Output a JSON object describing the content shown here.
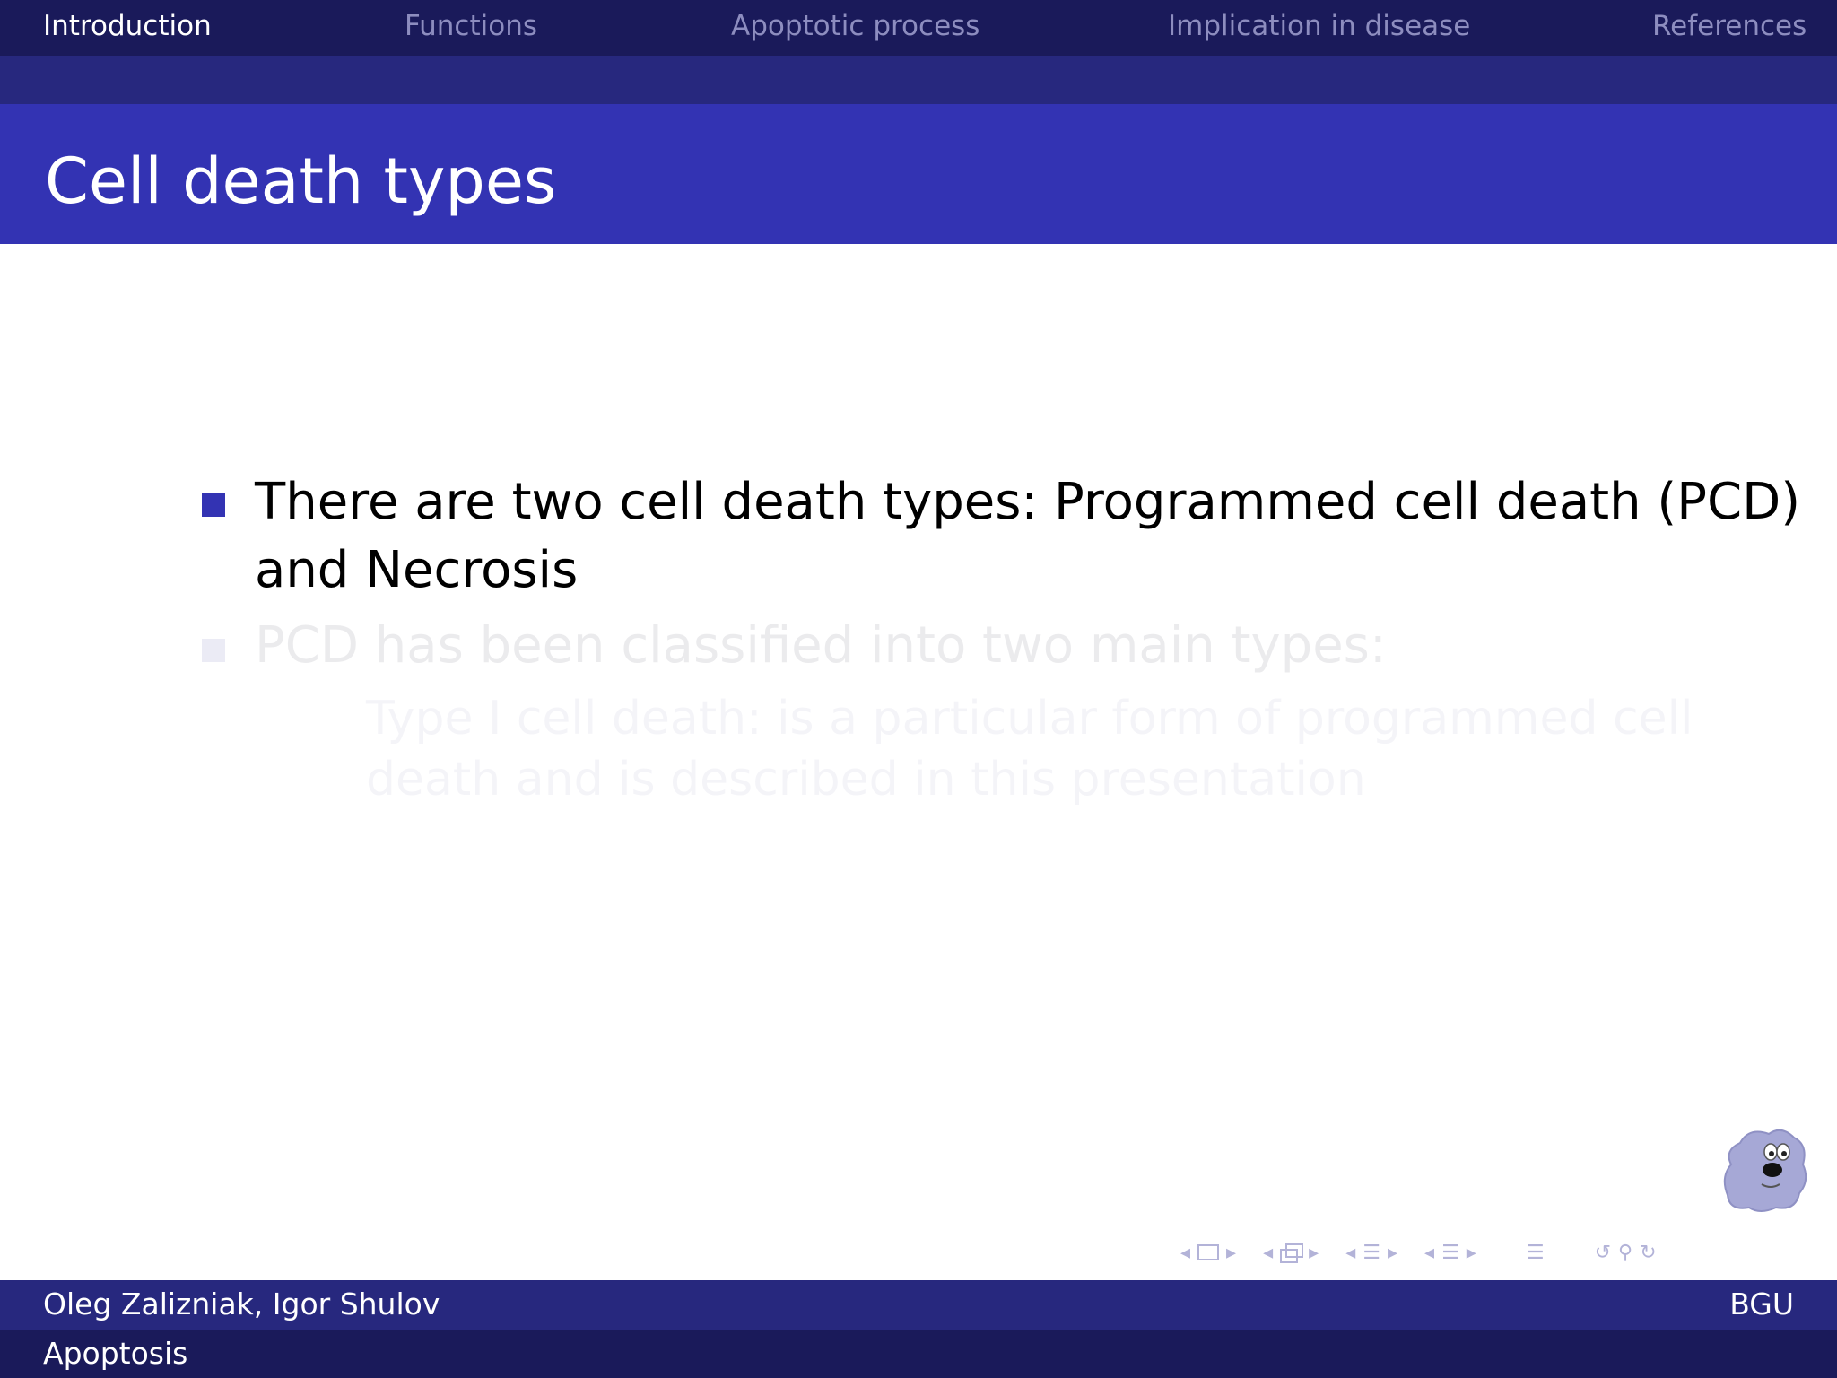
{
  "nav": {
    "sections": [
      "Introduction",
      "Functions",
      "Apoptotic process",
      "Implication in disease",
      "References"
    ],
    "active_index": 0
  },
  "frame": {
    "title": "Cell death types"
  },
  "bullets": [
    {
      "line1": "There are two cell death types: Programmed cell death (PCD)",
      "line2": "and Necrosis",
      "state": "visible"
    },
    {
      "line1": "PCD has been classified into two main types:",
      "state": "faded"
    }
  ],
  "subitem": {
    "line1": "Type I cell death: is a particular form of programmed cell",
    "line2": "death and is described in this presentation",
    "state": "faded"
  },
  "footer": {
    "authors": "Oleg Zalizniak, Igor Shulov",
    "institute": "BGU",
    "short_title": "Apoptosis"
  },
  "beamer_nav_icons": [
    "nav-frame-icon",
    "nav-subsection-icon",
    "nav-section-icon",
    "nav-document-icon",
    "nav-appendix-icon",
    "nav-back-icon",
    "nav-search-icon",
    "nav-forward-icon"
  ],
  "colors": {
    "nav_bg": "#1a1a5a",
    "subnav_bg": "#27287e",
    "title_bg": "#3333b3",
    "bullet": "#3333b3",
    "text": "#000000"
  }
}
